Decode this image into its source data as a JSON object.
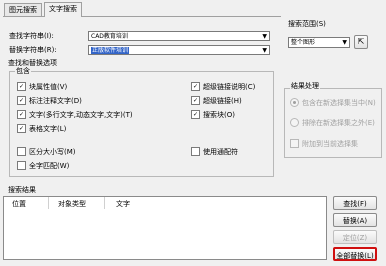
{
  "tabs": [
    {
      "label": "图元搜索"
    },
    {
      "label": "文字搜索"
    }
  ],
  "find": {
    "label": "查找字符串(I):",
    "value": "CAD教育培训"
  },
  "replace": {
    "label": "替换字符串(R):",
    "value": "正版软件培训"
  },
  "search_scope": {
    "label": "搜索范围(S)",
    "value": "整个图形"
  },
  "options": {
    "title": "查找和替换选项",
    "include_label": "包含",
    "checkboxes": [
      {
        "label": "块属性值(V)",
        "checked": true
      },
      {
        "label": "标注注释文字(D)",
        "checked": true
      },
      {
        "label": "文字(多行文字,动态文字,文字)(T)",
        "checked": true
      },
      {
        "label": "表格文字(L)",
        "checked": true
      },
      {
        "label": "超级链接说明(C)",
        "checked": true
      },
      {
        "label": "超级链接(H)",
        "checked": true
      },
      {
        "label": "搜索块(O)",
        "checked": true
      },
      {
        "label": "区分大小写(M)",
        "checked": false
      },
      {
        "label": "全字匹配(W)",
        "checked": false
      },
      {
        "label": "使用通配符",
        "checked": false
      }
    ]
  },
  "result_handling": {
    "title": "结果处理",
    "radio_include": "包含在新选择集当中(N)",
    "radio_exclude": "排除在新选择集之外(E)",
    "append_label": "附加到当前选择集"
  },
  "results": {
    "title": "搜索结果",
    "columns": [
      "位置",
      "对象类型",
      "文字"
    ]
  },
  "buttons": {
    "find": "查找(F)",
    "replace": "替换(A)",
    "locate": "定位(Z)",
    "replace_all": "全部替换(L)"
  }
}
